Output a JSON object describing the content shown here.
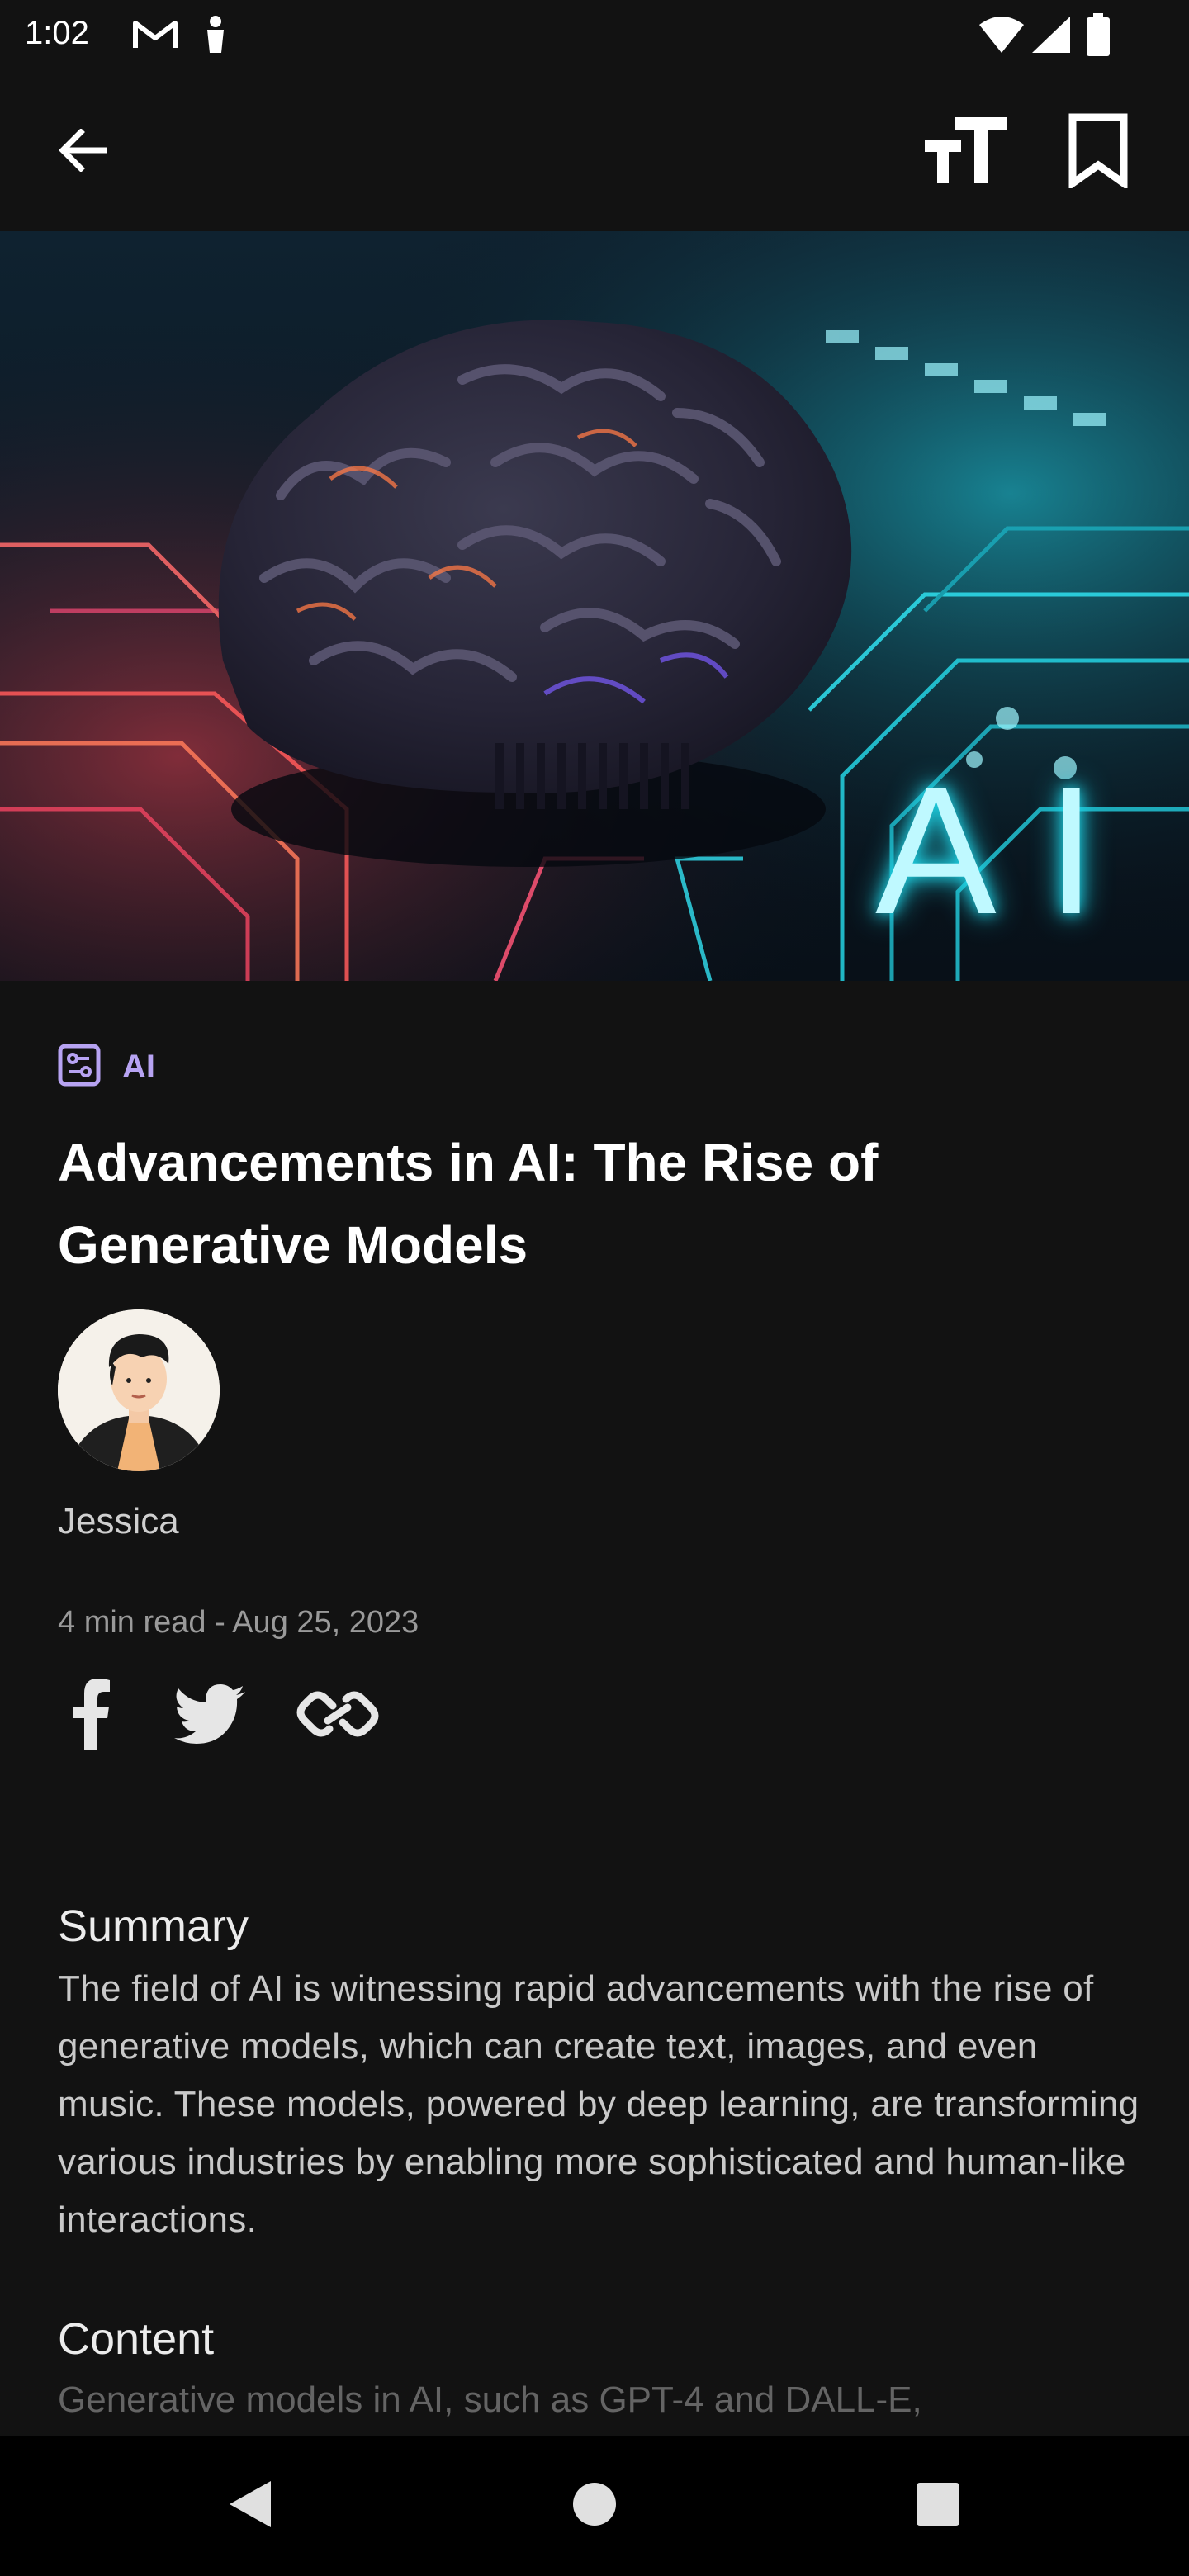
{
  "status_bar": {
    "time": "1:02",
    "icons": [
      "gmail-icon",
      "notification-icon",
      "wifi-icon",
      "signal-icon",
      "battery-icon"
    ]
  },
  "app_bar": {
    "back_icon": "arrow-left-icon",
    "text_size_icon": "text-size-icon",
    "bookmark_icon": "bookmark-icon"
  },
  "hero": {
    "image_text": "AI"
  },
  "article": {
    "category": "AI",
    "category_icon": "category-icon",
    "title": "Advancements in AI: The Rise of Generative Models",
    "author": "Jessica",
    "meta": "4 min read - Aug 25, 2023",
    "share": [
      "facebook-icon",
      "twitter-icon",
      "link-icon"
    ],
    "summary_heading": "Summary",
    "summary": "The field of AI is witnessing rapid advancements with the rise of generative models, which can create text, images, and even music. These models, powered by deep learning, are transforming various industries by enabling more sophisticated and human-like interactions.",
    "content_heading": "Content",
    "content_preview": "Generative models in AI, such as GPT-4 and DALL-E,"
  },
  "colors": {
    "background": "#121212",
    "accent": "#b7a3f2",
    "nav_bar": "#000000"
  }
}
